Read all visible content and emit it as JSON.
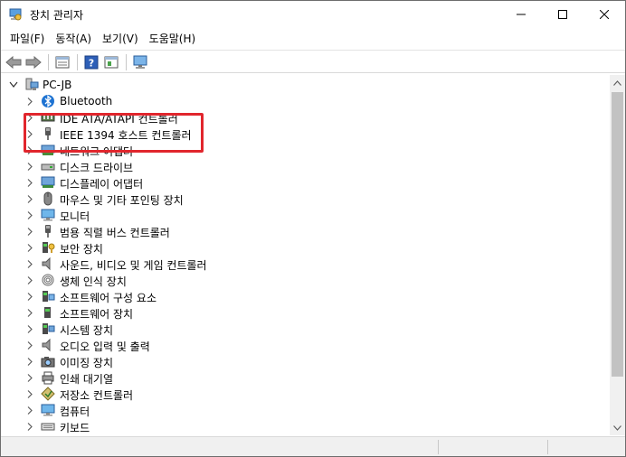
{
  "window": {
    "title": "장치 관리자",
    "icon": "device-manager-icon"
  },
  "menu": [
    "파일(F)",
    "동작(A)",
    "보기(V)",
    "도움말(H)"
  ],
  "toolbar": {
    "buttons": [
      "back-arrow-icon",
      "forward-arrow-icon",
      "properties-icon",
      "help-icon",
      "show-hidden-icon",
      "scan-hardware-icon"
    ]
  },
  "tree": {
    "root": "PC-JB",
    "items": [
      {
        "label": "Bluetooth",
        "icon": "bluetooth-icon"
      },
      {
        "label": "IDE ATA/ATAPI 컨트롤러",
        "icon": "ide-controller-icon"
      },
      {
        "label": "IEEE 1394 호스트 컨트롤러",
        "icon": "ieee1394-icon"
      },
      {
        "label": "네트워크 어댑터",
        "icon": "network-adapter-icon"
      },
      {
        "label": "디스크 드라이브",
        "icon": "disk-drive-icon"
      },
      {
        "label": "디스플레이 어댑터",
        "icon": "display-adapter-icon"
      },
      {
        "label": "마우스 및 기타 포인팅 장치",
        "icon": "mouse-icon"
      },
      {
        "label": "모니터",
        "icon": "monitor-icon"
      },
      {
        "label": "범용 직렬 버스 컨트롤러",
        "icon": "usb-controller-icon"
      },
      {
        "label": "보안 장치",
        "icon": "security-device-icon"
      },
      {
        "label": "사운드, 비디오 및 게임 컨트롤러",
        "icon": "sound-icon"
      },
      {
        "label": "생체 인식 장치",
        "icon": "biometric-icon"
      },
      {
        "label": "소프트웨어 구성 요소",
        "icon": "software-component-icon"
      },
      {
        "label": "소프트웨어 장치",
        "icon": "software-device-icon"
      },
      {
        "label": "시스템 장치",
        "icon": "system-device-icon"
      },
      {
        "label": "오디오 입력 및 출력",
        "icon": "audio-io-icon"
      },
      {
        "label": "이미징 장치",
        "icon": "imaging-device-icon"
      },
      {
        "label": "인쇄 대기열",
        "icon": "print-queue-icon"
      },
      {
        "label": "저장소 컨트롤러",
        "icon": "storage-controller-icon"
      },
      {
        "label": "컴퓨터",
        "icon": "computer-icon"
      },
      {
        "label": "키보드",
        "icon": "keyboard-icon"
      }
    ]
  },
  "colors": {
    "highlight": "#e1262d",
    "scroll_thumb": "#c2c2c2",
    "accent_blue": "#1e73d2"
  }
}
